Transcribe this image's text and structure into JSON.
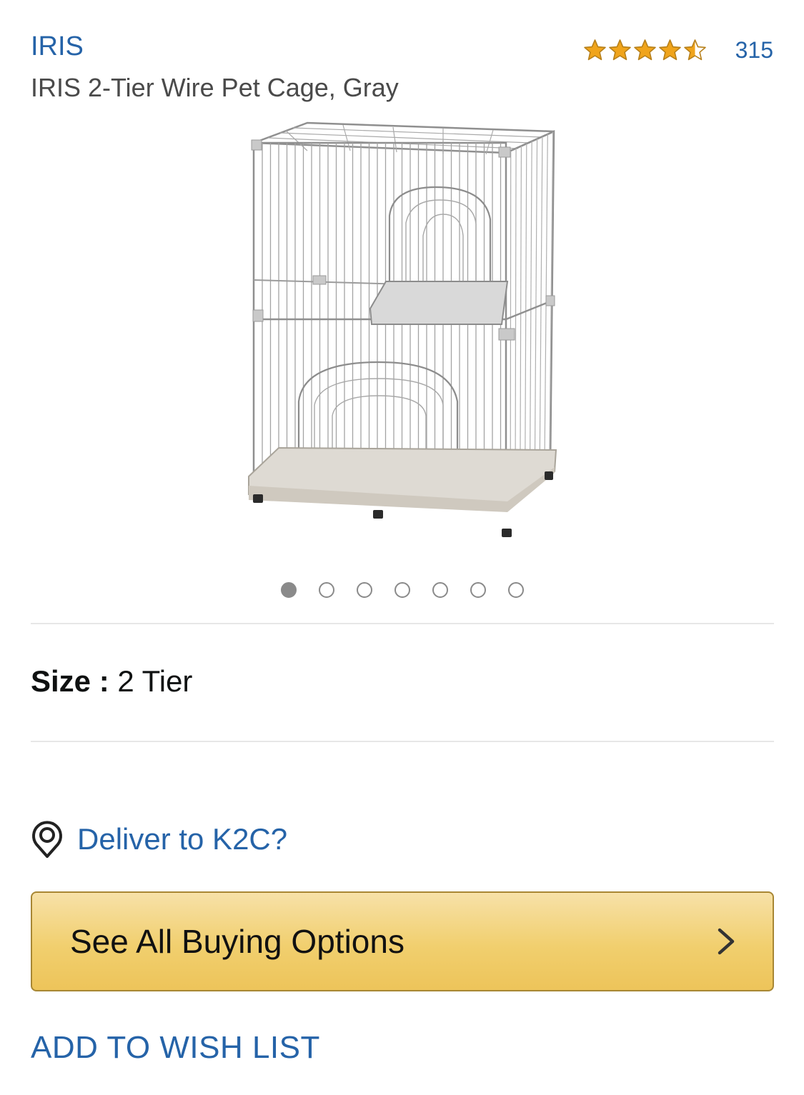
{
  "header": {
    "brand": "IRIS",
    "title": "IRIS 2-Tier Wire Pet Cage, Gray",
    "rating": {
      "stars": 4.5,
      "max": 5,
      "count": "315",
      "star_color": "#f0a41b"
    }
  },
  "gallery": {
    "image_icon": "wire-pet-cage-image",
    "total_images": 7,
    "active_index": 0
  },
  "size": {
    "label": "Size :",
    "value": "2 Tier"
  },
  "delivery": {
    "icon": "location-pin-icon",
    "text": "Deliver to K2C?"
  },
  "buy_button": {
    "label": "See All Buying Options",
    "icon": "chevron-right-icon"
  },
  "wishlist": {
    "label": "ADD TO WISH LIST"
  },
  "colors": {
    "link": "#2563a8",
    "button_top": "#f7e1a8",
    "button_bottom": "#edc45a",
    "button_border": "#a88734"
  }
}
